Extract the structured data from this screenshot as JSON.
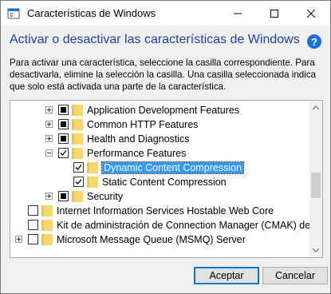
{
  "window": {
    "title": "Características de Windows"
  },
  "heading": "Activar o desactivar las características de Windows",
  "help_glyph": "?",
  "description": "Para activar una característica, seleccione la casilla correspondiente. Para desactivarla, elimine la selección la casilla. Una casilla seleccionada indica que solo está activada una parte de la característica.",
  "tree": {
    "items": [
      {
        "label": "Application Development Features",
        "expander": "plus",
        "state": "partial",
        "level": 2,
        "selected": false
      },
      {
        "label": "Common HTTP Features",
        "expander": "plus",
        "state": "partial",
        "level": 2,
        "selected": false
      },
      {
        "label": "Health and Diagnostics",
        "expander": "plus",
        "state": "partial",
        "level": 2,
        "selected": false
      },
      {
        "label": "Performance Features",
        "expander": "minus",
        "state": "checked",
        "level": 2,
        "selected": false
      },
      {
        "label": "Dynamic Content Compression",
        "expander": "none",
        "state": "checked",
        "level": 3,
        "selected": true
      },
      {
        "label": "Static Content Compression",
        "expander": "none",
        "state": "checked",
        "level": 3,
        "selected": false
      },
      {
        "label": "Security",
        "expander": "plus",
        "state": "partial",
        "level": 2,
        "selected": false
      },
      {
        "label": "Internet Information Services Hostable Web Core",
        "expander": "none",
        "state": "empty",
        "level": 0,
        "selected": false
      },
      {
        "label": "Kit de administración de Connection Manager (CMAK) de RAS",
        "expander": "none",
        "state": "empty",
        "level": 0,
        "selected": false
      },
      {
        "label": "Microsoft Message Queue (MSMQ) Server",
        "expander": "plus",
        "state": "empty",
        "level": 0,
        "selected": false
      }
    ]
  },
  "buttons": {
    "ok": "Aceptar",
    "cancel": "Cancelar"
  },
  "colors": {
    "heading": "#1f3fa5",
    "selection": "#3399ff",
    "folder": "#f5d76e",
    "accent": "#0078d7"
  }
}
